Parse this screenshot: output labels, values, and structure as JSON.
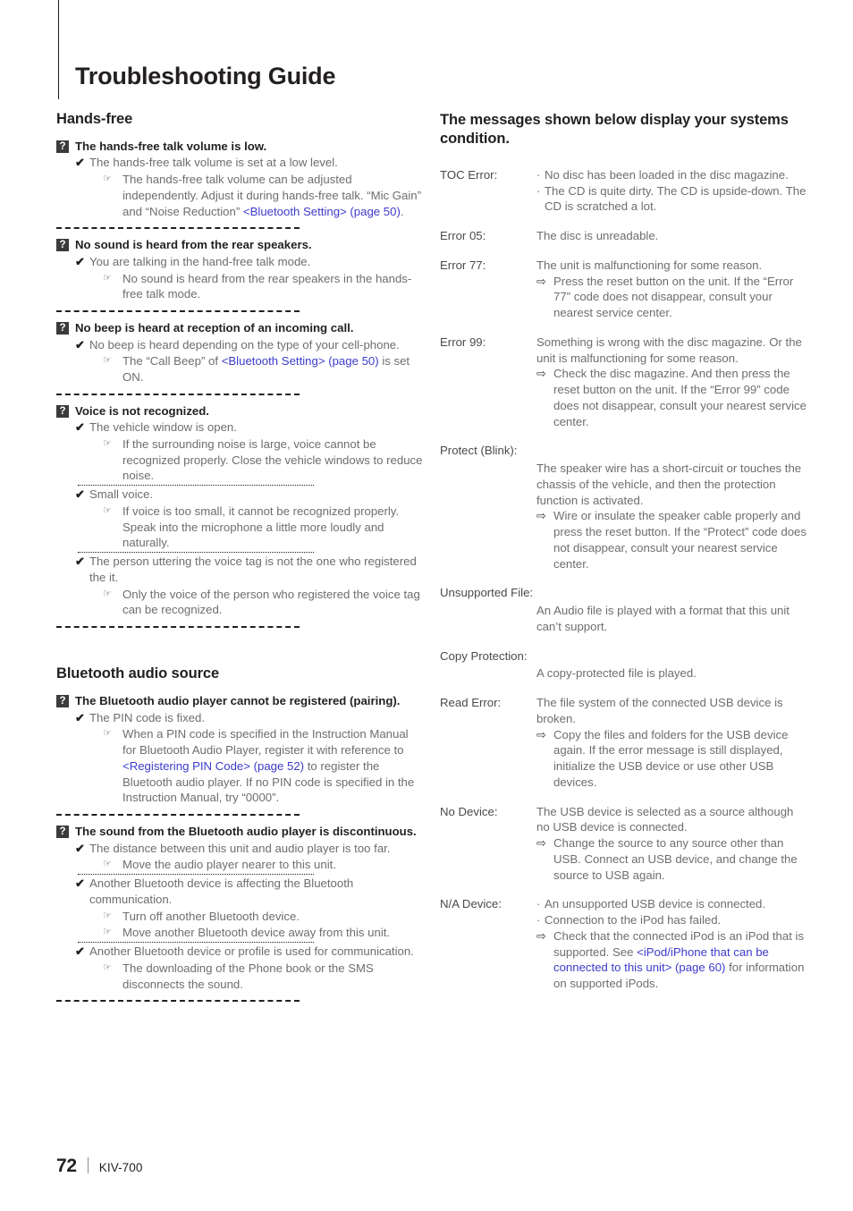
{
  "page": {
    "title": "Troubleshooting Guide",
    "footer": {
      "page_number": "72",
      "model": "KIV-700"
    },
    "link_color": "#3c3ccc",
    "badge_color": "#3c3a3b"
  },
  "icons": {
    "question_badge": "?",
    "check_mark": "✔",
    "pointing_hand": "☞",
    "arrow_remedy": "⇨",
    "bullet": "·"
  },
  "left_column": {
    "sections": [
      {
        "heading": "Hands-free",
        "problems": [
          {
            "question": "The hands-free talk volume is low.",
            "causes": [
              {
                "cause": "The hands-free talk volume is set at a low level.",
                "remedies": [
                  {
                    "parts": [
                      {
                        "t": "The hands-free talk volume can be adjusted independently. Adjust it during hands-free talk. “Mic Gain” and “Noise Reduction” "
                      },
                      {
                        "t": "<Bluetooth Setting> (page 50)",
                        "link": true
                      },
                      {
                        "t": "."
                      }
                    ]
                  }
                ]
              }
            ]
          },
          {
            "question": "No sound is heard from the rear speakers.",
            "causes": [
              {
                "cause": "You are talking in the hand-free talk mode.",
                "remedies": [
                  {
                    "parts": [
                      {
                        "t": "No sound is heard from the rear speakers in the hands-free talk mode."
                      }
                    ]
                  }
                ]
              }
            ]
          },
          {
            "question": "No beep is heard at reception of an incoming call.",
            "causes": [
              {
                "cause": "No beep is heard depending on the type of your cell-phone.",
                "remedies": [
                  {
                    "parts": [
                      {
                        "t": "The “Call Beep” of "
                      },
                      {
                        "t": "<Bluetooth Setting> (page 50)",
                        "link": true
                      },
                      {
                        "t": " is set ON."
                      }
                    ]
                  }
                ]
              }
            ]
          },
          {
            "question": "Voice is not recognized.",
            "causes": [
              {
                "cause": "The vehicle window is open.",
                "remedies": [
                  {
                    "parts": [
                      {
                        "t": "If the surrounding noise is large, voice cannot be recognized properly. Close the vehicle windows to reduce noise."
                      }
                    ]
                  }
                ]
              },
              {
                "cause": "Small voice.",
                "remedies": [
                  {
                    "parts": [
                      {
                        "t": "If voice is too small, it cannot be recognized properly. Speak into the microphone a little more loudly and naturally."
                      }
                    ]
                  }
                ]
              },
              {
                "cause": "The person uttering the voice tag is not the one who registered the it.",
                "remedies": [
                  {
                    "parts": [
                      {
                        "t": "Only the voice of the person who registered the voice tag can be recognized."
                      }
                    ]
                  }
                ]
              }
            ]
          }
        ]
      },
      {
        "heading": "Bluetooth audio source",
        "problems": [
          {
            "question": "The Bluetooth audio player cannot be registered (pairing).",
            "causes": [
              {
                "cause": "The PIN code is fixed.",
                "remedies": [
                  {
                    "parts": [
                      {
                        "t": "When a PIN code is specified in the Instruction Manual for Bluetooth Audio Player, register it with reference to "
                      },
                      {
                        "t": "<Registering PIN Code> (page 52)",
                        "link": true
                      },
                      {
                        "t": " to register the Bluetooth audio player. If no PIN code is specified in the Instruction Manual, try “0000”."
                      }
                    ]
                  }
                ]
              }
            ]
          },
          {
            "question": "The sound from the Bluetooth audio player is discontinuous.",
            "causes": [
              {
                "cause": "The distance between this unit and audio player is too far.",
                "remedies": [
                  {
                    "parts": [
                      {
                        "t": "Move the audio player nearer to this unit."
                      }
                    ]
                  }
                ]
              },
              {
                "cause": "Another Bluetooth device is affecting the Bluetooth communication.",
                "remedies": [
                  {
                    "parts": [
                      {
                        "t": "Turn off another Bluetooth device."
                      }
                    ]
                  },
                  {
                    "parts": [
                      {
                        "t": "Move another Bluetooth device away from this unit."
                      }
                    ]
                  }
                ]
              },
              {
                "cause": "Another Bluetooth device or profile is used for communication.",
                "remedies": [
                  {
                    "parts": [
                      {
                        "t": "The downloading of the Phone book or the SMS disconnects the sound."
                      }
                    ]
                  }
                ]
              }
            ]
          }
        ]
      }
    ]
  },
  "right_column": {
    "heading": "The messages shown below display your systems condition.",
    "messages": [
      {
        "label": "TOC Error:",
        "wide": false,
        "lines": [
          {
            "kind": "bullet",
            "text": "No disc has been loaded in the disc magazine."
          },
          {
            "kind": "bullet",
            "text": "The CD is quite dirty. The CD is upside-down. The CD is scratched a lot."
          }
        ]
      },
      {
        "label": "Error 05:",
        "wide": false,
        "lines": [
          {
            "kind": "plain",
            "text": "The disc is unreadable."
          }
        ]
      },
      {
        "label": "Error 77:",
        "wide": false,
        "lines": [
          {
            "kind": "plain",
            "text": "The unit is malfunctioning for some reason."
          },
          {
            "kind": "arrow",
            "text": "Press the reset button on the unit. If the “Error 77” code does not disappear, consult your nearest service center."
          }
        ]
      },
      {
        "label": "Error 99:",
        "wide": false,
        "lines": [
          {
            "kind": "plain",
            "text": "Something is wrong with the disc magazine. Or the unit is malfunctioning for some reason."
          },
          {
            "kind": "arrow",
            "text": "Check the disc magazine. And then press the reset button on the unit. If the “Error 99” code does not disappear, consult your nearest service center."
          }
        ]
      },
      {
        "label": "Protect (Blink):",
        "wide": true,
        "lines": [
          {
            "kind": "plain",
            "text": "The speaker wire has a short-circuit or touches the chassis of the vehicle, and then the protection function is activated."
          },
          {
            "kind": "arrow",
            "text": "Wire or insulate the speaker cable properly and press the reset button. If the “Protect” code does not disappear, consult your nearest service center."
          }
        ]
      },
      {
        "label": "Unsupported File:",
        "wide": true,
        "lines": [
          {
            "kind": "plain",
            "text": "An Audio file is played with a format that this unit can’t support."
          }
        ]
      },
      {
        "label": "Copy Protection:",
        "wide": true,
        "lines": [
          {
            "kind": "plain",
            "text": "A copy-protected file is played."
          }
        ]
      },
      {
        "label": "Read Error:",
        "wide": false,
        "lines": [
          {
            "kind": "plain",
            "text": "The file system of the connected USB device is broken."
          },
          {
            "kind": "arrow",
            "text": "Copy the files and folders for the USB device again. If the error message is still displayed, initialize the USB device or use other USB devices."
          }
        ]
      },
      {
        "label": "No Device:",
        "wide": false,
        "lines": [
          {
            "kind": "plain",
            "text": "The USB device is selected as a source although no USB device is connected."
          },
          {
            "kind": "arrow",
            "text": "Change the source to any source other than USB. Connect an USB device, and change the source to USB again."
          }
        ]
      },
      {
        "label": "N/A Device:",
        "wide": false,
        "lines": [
          {
            "kind": "bullet",
            "text": "An unsupported USB device is connected."
          },
          {
            "kind": "bullet",
            "text": "Connection to the iPod has failed."
          },
          {
            "kind": "arrow",
            "parts": [
              {
                "t": "Check that the connected iPod is an iPod that is supported. See "
              },
              {
                "t": "<iPod/iPhone that can be connected to this unit> (page 60)",
                "link": true
              },
              {
                "t": " for information on supported iPods."
              }
            ]
          }
        ]
      }
    ]
  }
}
